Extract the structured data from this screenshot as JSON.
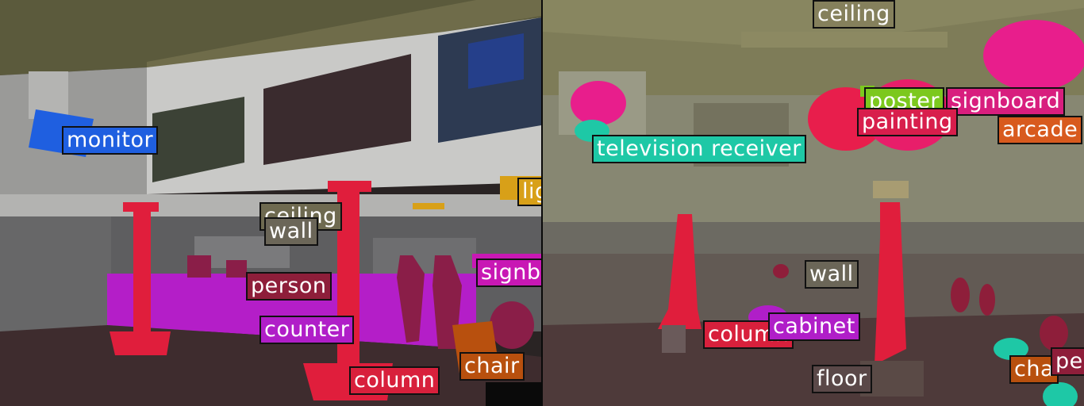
{
  "left_panel": {
    "labels": [
      {
        "id": "monitor",
        "text": "monitor",
        "color": "#1f5fe0"
      },
      {
        "id": "ceiling",
        "text": "ceiling",
        "color": "#6e6a50"
      },
      {
        "id": "wall",
        "text": "wall",
        "color": "#6b6658"
      },
      {
        "id": "person",
        "text": "person",
        "color": "#8e1e3a"
      },
      {
        "id": "counter",
        "text": "counter",
        "color": "#b01ec8"
      },
      {
        "id": "column",
        "text": "column",
        "color": "#d8203c"
      },
      {
        "id": "chair",
        "text": "chair",
        "color": "#b8500e"
      },
      {
        "id": "signboard",
        "text": "signb",
        "color": "#c818b4"
      },
      {
        "id": "light",
        "text": "lig",
        "color": "#d8a018"
      }
    ]
  },
  "right_panel": {
    "labels": [
      {
        "id": "ceiling",
        "text": "ceiling",
        "color": "#85805c"
      },
      {
        "id": "poster",
        "text": "poster",
        "color": "#7cc81e"
      },
      {
        "id": "signboard",
        "text": "signboard",
        "color": "#d81e7e"
      },
      {
        "id": "painting",
        "text": "painting",
        "color": "#d81e4c"
      },
      {
        "id": "arcade",
        "text": "arcade",
        "color": "#d85a1e"
      },
      {
        "id": "television-receiver",
        "text": "television receiver",
        "color": "#1ec8a6"
      },
      {
        "id": "wall",
        "text": "wall",
        "color": "#6b6658"
      },
      {
        "id": "column",
        "text": "column",
        "color": "#d8203c"
      },
      {
        "id": "cabinet",
        "text": "cabinet",
        "color": "#b01ec8"
      },
      {
        "id": "floor",
        "text": "floor",
        "color": "#5a4848"
      },
      {
        "id": "chair",
        "text": "cha",
        "color": "#b8500e"
      },
      {
        "id": "person",
        "text": "pe",
        "color": "#8e1e3a"
      }
    ]
  }
}
